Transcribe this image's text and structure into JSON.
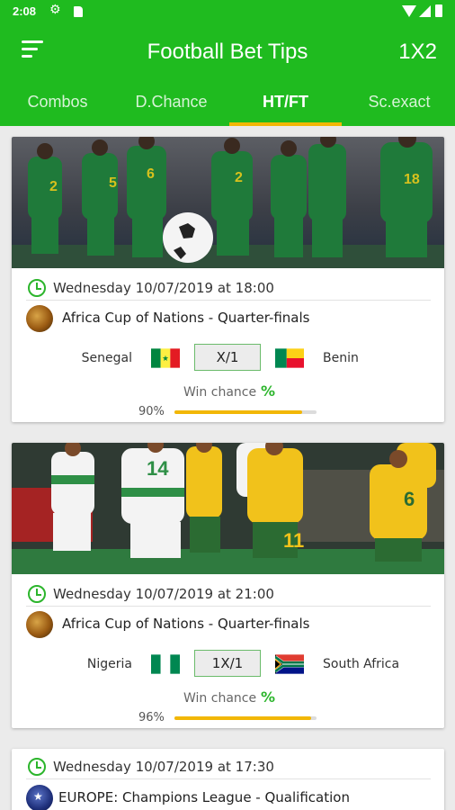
{
  "status_bar": {
    "time": "2:08"
  },
  "header": {
    "title": "Football Bet Tips",
    "right_action": "1X2"
  },
  "tabs": [
    {
      "label": "Combos",
      "active": false
    },
    {
      "label": "D.Chance",
      "active": false
    },
    {
      "label": "HT/FT",
      "active": true
    },
    {
      "label": "Sc.exact",
      "active": false
    }
  ],
  "colors": {
    "primary": "#1fbb1f",
    "accent": "#f2b705",
    "clock": "#2cb52c"
  },
  "matches": [
    {
      "datetime": "Wednesday 10/07/2019 at 18:00",
      "league": "Africa Cup of Nations - Quarter-finals",
      "home": "Senegal",
      "away": "Benin",
      "tip": "X/1",
      "win_label": "Win chance",
      "win_icon": "%",
      "percent_text": "90%",
      "percent": 90
    },
    {
      "datetime": "Wednesday 10/07/2019 at 21:00",
      "league": "Africa Cup of Nations - Quarter-finals",
      "home": "Nigeria",
      "away": "South Africa",
      "tip": "1X/1",
      "win_label": "Win chance",
      "win_icon": "%",
      "percent_text": "96%",
      "percent": 96
    },
    {
      "datetime": "Wednesday 10/07/2019  at 17:30",
      "league": "EUROPE: Champions League - Qualification"
    }
  ]
}
